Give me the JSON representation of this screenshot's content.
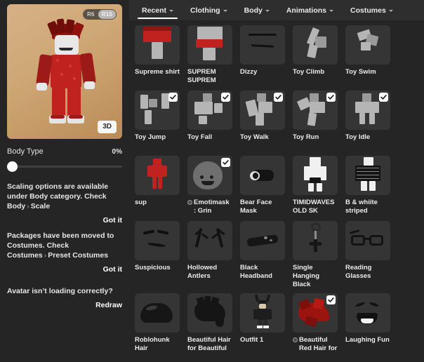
{
  "avatar_preview": {
    "rig_toggle": {
      "options": [
        "R6",
        "R15"
      ],
      "selected": "R15"
    },
    "view_button": "3D"
  },
  "body_type": {
    "label": "Body Type",
    "value_text": "0%",
    "value": 0
  },
  "notices": [
    {
      "text_part1": "Scaling options are available under Body category. Check",
      "crumb1": "Body",
      "separator": "›",
      "crumb2": "Scale",
      "action": "Got it"
    },
    {
      "text_part1": "Packages have been moved to Costumes. Check",
      "crumb1": "Costumes",
      "separator": "›",
      "crumb2": "Preset Costumes",
      "action": "Got it"
    }
  ],
  "redraw_notice": {
    "text": "Avatar isn’t loading correctly?",
    "action": "Redraw"
  },
  "tabs": [
    {
      "label": "Recent",
      "active": true,
      "has_dropdown": true
    },
    {
      "label": "Clothing",
      "active": false,
      "has_dropdown": true
    },
    {
      "label": "Body",
      "active": false,
      "has_dropdown": true
    },
    {
      "label": "Animations",
      "active": false,
      "has_dropdown": true
    },
    {
      "label": "Costumes",
      "active": false,
      "has_dropdown": true
    }
  ],
  "items": [
    {
      "label": "Supreme shirt",
      "checked": false,
      "badge": false
    },
    {
      "label": "SUPREM SUPREM",
      "checked": false,
      "badge": false
    },
    {
      "label": "Dizzy",
      "checked": false,
      "badge": false
    },
    {
      "label": "Toy Climb",
      "checked": false,
      "badge": false
    },
    {
      "label": "Toy Swim",
      "checked": false,
      "badge": false
    },
    {
      "label": "Toy Jump",
      "checked": true,
      "badge": false
    },
    {
      "label": "Toy Fall",
      "checked": true,
      "badge": false
    },
    {
      "label": "Toy Walk",
      "checked": true,
      "badge": false
    },
    {
      "label": "Toy Run",
      "checked": true,
      "badge": false
    },
    {
      "label": "Toy Idle",
      "checked": true,
      "badge": false
    },
    {
      "label": "sup",
      "checked": false,
      "badge": false
    },
    {
      "label": "Emotimask : Grin",
      "checked": true,
      "badge": true
    },
    {
      "label": "Bear Face Mask",
      "checked": false,
      "badge": false
    },
    {
      "label": "TIMIDWAVES OLD SK",
      "checked": false,
      "badge": false
    },
    {
      "label": "B & whiite striped",
      "checked": false,
      "badge": false
    },
    {
      "label": "Suspicious",
      "checked": false,
      "badge": false
    },
    {
      "label": "Hollowed Antlers",
      "checked": false,
      "badge": false
    },
    {
      "label": "Black Headband",
      "checked": false,
      "badge": false
    },
    {
      "label": "Single Hanging Black",
      "checked": false,
      "badge": false
    },
    {
      "label": "Reading Glasses",
      "checked": false,
      "badge": false
    },
    {
      "label": "Roblohunk Hair",
      "checked": false,
      "badge": false
    },
    {
      "label": "Beautiful Hair for Beautiful",
      "checked": false,
      "badge": false
    },
    {
      "label": "Outfit 1",
      "checked": false,
      "badge": false
    },
    {
      "label": "Beautiful Red Hair for",
      "checked": true,
      "badge": true
    },
    {
      "label": "Laughing Fun",
      "checked": false,
      "badge": false
    }
  ],
  "colors": {
    "page_background": "#252525",
    "tabbar_background": "#2e2e2e",
    "tile_background": "#353535",
    "text_primary": "#ececec",
    "accent_underline": "#ffffff",
    "avatar_backdrop": "#cfa877",
    "avatar_shirt": "#c0231f"
  },
  "icons": {
    "chevron_down": "chevron-down-icon",
    "checkmark": "checkmark-icon"
  }
}
